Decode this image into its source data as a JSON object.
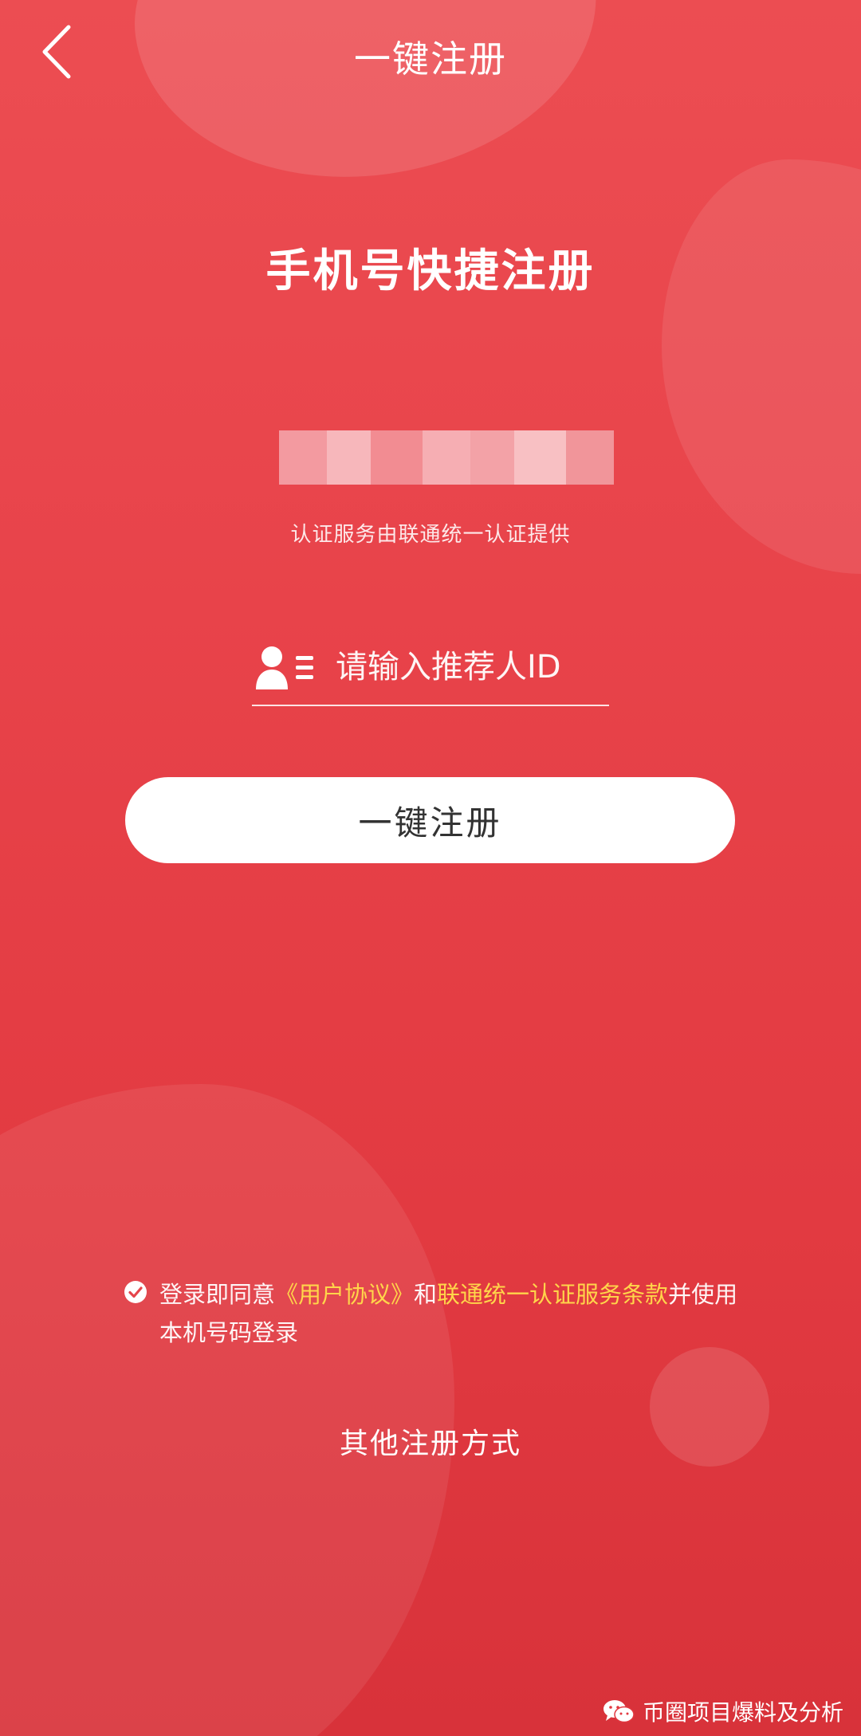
{
  "header": {
    "title": "一键注册",
    "back_icon": "chevron-left-icon"
  },
  "main": {
    "title": "手机号快捷注册",
    "masked_phone_colors": [
      "#f39aa0",
      "#f7b7bb",
      "#f28c92",
      "#f6aeb3",
      "#f3a2a7",
      "#f8c0c3",
      "#f1959a"
    ],
    "auth_provider": "认证服务由联通统一认证提供",
    "referrer": {
      "placeholder": "请输入推荐人ID",
      "value": "",
      "icon": "user-list-icon"
    },
    "register_button": "一键注册"
  },
  "agreement": {
    "prefix": "登录即同意",
    "user_agreement_link": "《用户协议》",
    "and": "和",
    "terms_link": "联通统一认证服务条款",
    "suffix": "并使用本机号码登录",
    "check_icon": "check-circle-icon",
    "link_color": "#ffd54a"
  },
  "other_methods": "其他注册方式",
  "watermark": {
    "text": "币圈项目爆料及分析",
    "icon": "wechat-icon"
  },
  "colors": {
    "background_top": "#ec4d52",
    "background_bottom": "#d8323a",
    "button_background": "#ffffff"
  }
}
